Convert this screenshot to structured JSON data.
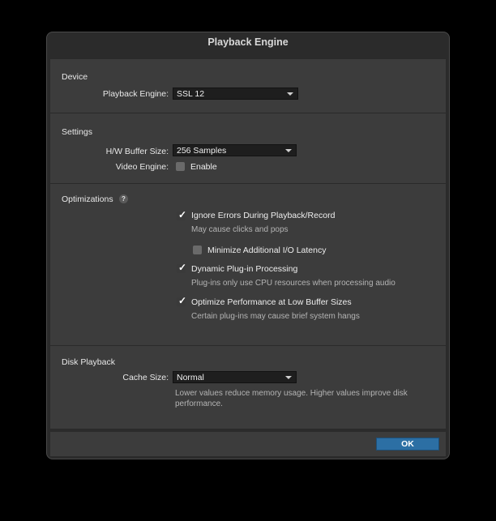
{
  "dialog": {
    "title": "Playback Engine"
  },
  "device": {
    "section_title": "Device",
    "playback_engine_label": "Playback Engine:",
    "playback_engine_value": "SSL 12"
  },
  "settings": {
    "section_title": "Settings",
    "buffer_label": "H/W Buffer Size:",
    "buffer_value": "256 Samples",
    "video_engine_label": "Video Engine:",
    "video_engine_option": "Enable",
    "video_engine_checked": false
  },
  "optimizations": {
    "section_title": "Optimizations",
    "help_glyph": "?",
    "items": [
      {
        "label": "Ignore Errors During Playback/Record",
        "checked": true,
        "hint": "May cause clicks and pops"
      },
      {
        "label": "Minimize Additional I/O Latency",
        "checked": false
      },
      {
        "label": "Dynamic Plug-in Processing",
        "checked": true,
        "hint": "Plug-ins only use CPU resources when processing audio"
      },
      {
        "label": "Optimize Performance at Low Buffer Sizes",
        "checked": true,
        "hint": "Certain plug-ins may cause brief system hangs"
      }
    ]
  },
  "disk_playback": {
    "section_title": "Disk Playback",
    "cache_label": "Cache Size:",
    "cache_value": "Normal",
    "hint_line1": "Lower values reduce memory usage. Higher values improve disk",
    "hint_line2": "performance."
  },
  "footer": {
    "ok_label": "OK"
  },
  "colors": {
    "accent": "#2c6fa4",
    "panel": "#3c3c3c",
    "background": "#000000"
  },
  "icons": {
    "check": "check-icon",
    "dropdown": "chevron-down-icon",
    "help": "help-icon"
  }
}
